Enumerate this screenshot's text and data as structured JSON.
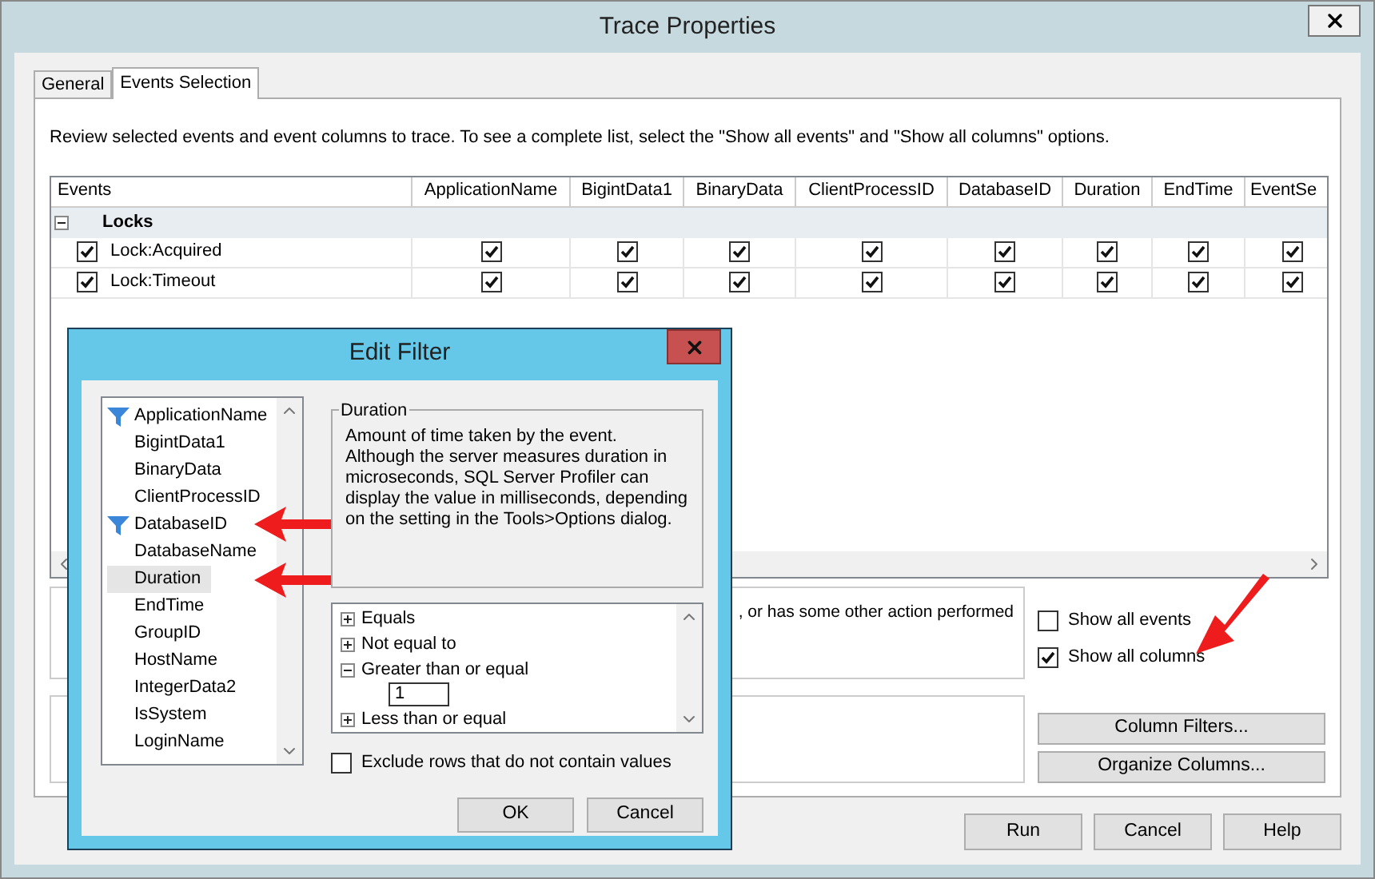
{
  "window": {
    "title": "Trace Properties"
  },
  "tabs": [
    {
      "label": "General",
      "selected": false
    },
    {
      "label": "Events Selection",
      "selected": true
    }
  ],
  "instructions": "Review selected events and event columns to trace. To see a complete list, select the \"Show all events\" and \"Show all columns\" options.",
  "grid": {
    "columns": [
      "Events",
      "ApplicationName",
      "BigintData1",
      "BinaryData",
      "ClientProcessID",
      "DatabaseID",
      "Duration",
      "EndTime",
      "EventSe"
    ],
    "categories": [
      {
        "name": "Locks",
        "expanded": true,
        "events": [
          {
            "name": "Lock:Acquired",
            "checked": true,
            "cells": [
              true,
              true,
              true,
              true,
              true,
              true,
              true,
              true
            ]
          },
          {
            "name": "Lock:Timeout",
            "checked": true,
            "cells": [
              true,
              true,
              true,
              true,
              true,
              true,
              true,
              true
            ]
          }
        ]
      }
    ]
  },
  "description_fragment": ", or has some other action performed",
  "options": [
    {
      "label": "Show all events",
      "checked": false
    },
    {
      "label": "Show all columns",
      "checked": true
    }
  ],
  "side_buttons": [
    "Column Filters...",
    "Organize Columns..."
  ],
  "buttons": [
    "Run",
    "Cancel",
    "Help"
  ],
  "edit_filter": {
    "title": "Edit Filter",
    "columns": [
      {
        "name": "ApplicationName",
        "filtered": true,
        "selected": false
      },
      {
        "name": "BigintData1",
        "filtered": false,
        "selected": false
      },
      {
        "name": "BinaryData",
        "filtered": false,
        "selected": false
      },
      {
        "name": "ClientProcessID",
        "filtered": false,
        "selected": false
      },
      {
        "name": "DatabaseID",
        "filtered": true,
        "selected": false
      },
      {
        "name": "DatabaseName",
        "filtered": false,
        "selected": false
      },
      {
        "name": "Duration",
        "filtered": false,
        "selected": true
      },
      {
        "name": "EndTime",
        "filtered": false,
        "selected": false
      },
      {
        "name": "GroupID",
        "filtered": false,
        "selected": false
      },
      {
        "name": "HostName",
        "filtered": false,
        "selected": false
      },
      {
        "name": "IntegerData2",
        "filtered": false,
        "selected": false
      },
      {
        "name": "IsSystem",
        "filtered": false,
        "selected": false
      },
      {
        "name": "LoginName",
        "filtered": false,
        "selected": false
      }
    ],
    "description_title": "Duration",
    "description": "Amount of time taken by the event. Although the server measures duration in microseconds, SQL Server Profiler can display the value in milliseconds, depending on the setting in the Tools>Options dialog.",
    "operators": [
      {
        "label": "Equals",
        "expanded": false
      },
      {
        "label": "Not equal to",
        "expanded": false
      },
      {
        "label": "Greater than or equal",
        "expanded": true,
        "value": "1"
      },
      {
        "label": "Less than or equal",
        "expanded": false
      }
    ],
    "exclude": {
      "label": "Exclude rows that do not contain values",
      "checked": false
    },
    "buttons": [
      "OK",
      "Cancel"
    ]
  }
}
